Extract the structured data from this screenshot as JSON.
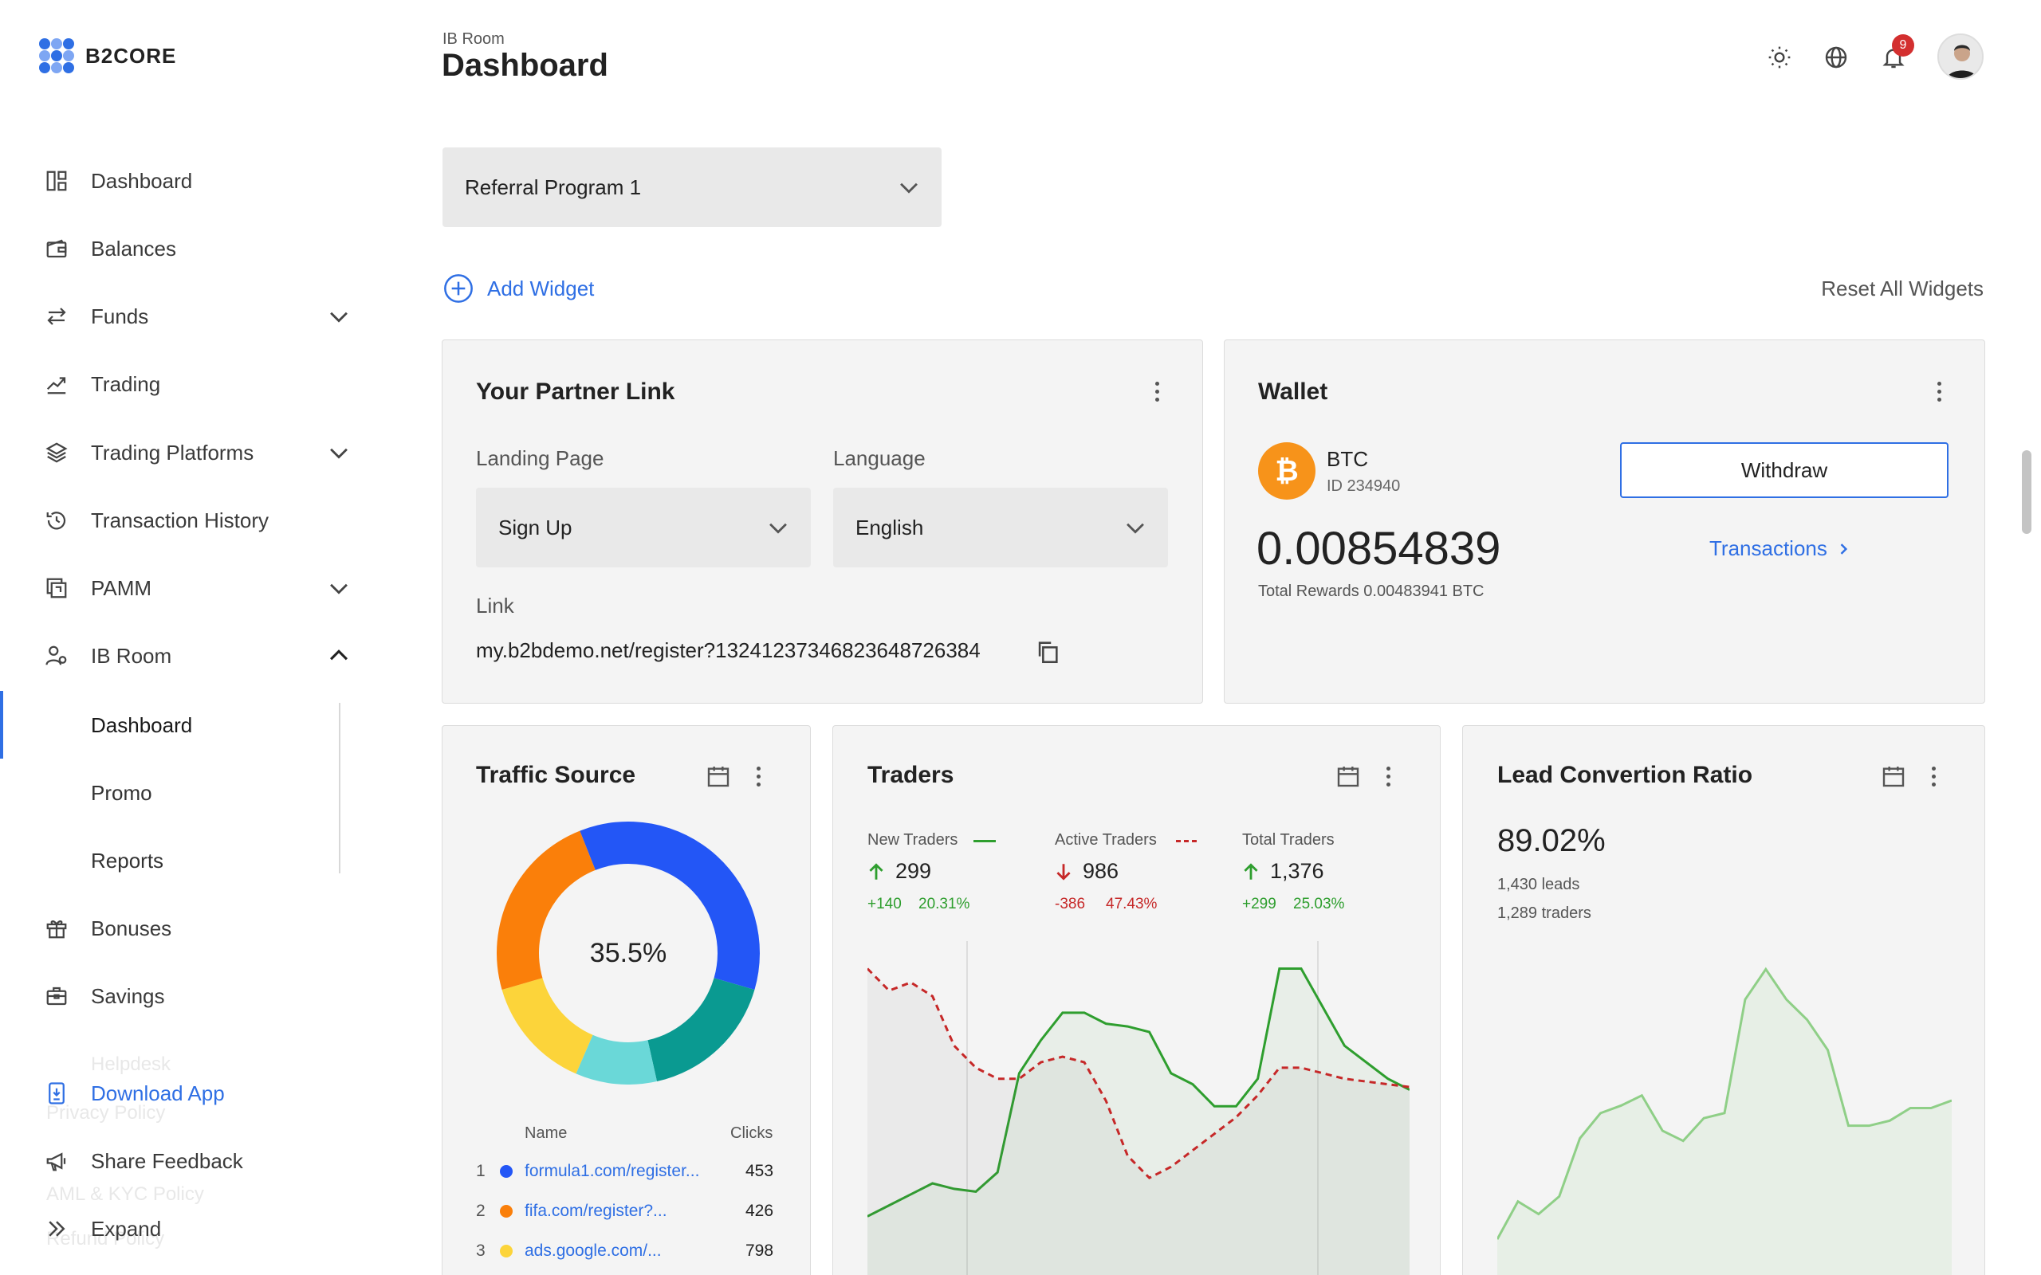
{
  "app": {
    "brand": "B2CORE"
  },
  "colors": {
    "accent": "#2f6fe4",
    "positive": "#2e9e2e",
    "negative": "#c62828",
    "btc": "#f7931a"
  },
  "sidebar": {
    "items": [
      {
        "label": "Dashboard",
        "icon": "dashboard-icon"
      },
      {
        "label": "Balances",
        "icon": "wallet-icon"
      },
      {
        "label": "Funds",
        "icon": "transfer-icon",
        "expandable": true
      },
      {
        "label": "Trading",
        "icon": "trending-icon"
      },
      {
        "label": "Trading Platforms",
        "icon": "layers-icon",
        "expandable": true
      },
      {
        "label": "Transaction History",
        "icon": "history-icon"
      },
      {
        "label": "PAMM",
        "icon": "pamm-icon",
        "expandable": true
      },
      {
        "label": "IB Room",
        "icon": "ib-room-icon",
        "expanded": true
      },
      {
        "label": "Bonuses",
        "icon": "gift-icon"
      },
      {
        "label": "Savings",
        "icon": "savings-icon"
      }
    ],
    "sub_items": [
      {
        "label": "Dashboard",
        "active": true
      },
      {
        "label": "Promo"
      },
      {
        "label": "Reports"
      }
    ],
    "ghost_items": [
      "Helpdesk",
      "Privacy Policy",
      "AML & KYC Policy",
      "Refund Policy"
    ],
    "bottom": {
      "download": "Download App",
      "feedback": "Share Feedback",
      "expand": "Expand"
    }
  },
  "header": {
    "breadcrumb": "IB Room",
    "title": "Dashboard",
    "notification_count": "9"
  },
  "program_select": {
    "value": "Referral Program 1"
  },
  "actions": {
    "add_widget": "Add Widget",
    "reset_widgets": "Reset All Widgets"
  },
  "partner_link": {
    "title": "Your Partner Link",
    "landing_label": "Landing Page",
    "landing_value": "Sign Up",
    "language_label": "Language",
    "language_value": "English",
    "link_label": "Link",
    "link_value": "my.b2bdemo.net/register?132412373468236487263​84"
  },
  "wallet": {
    "title": "Wallet",
    "currency": "BTC",
    "id": "ID 234940",
    "balance": "0.00854839",
    "rewards": "Total Rewards 0.00483941 BTC",
    "withdraw": "Withdraw",
    "transactions": "Transactions"
  },
  "traffic": {
    "title": "Traffic Source",
    "center": "35.5%",
    "col_name": "Name",
    "col_clicks": "Clicks",
    "rows": [
      {
        "num": "1",
        "name": "formula1.com/register...",
        "clicks": "453",
        "color": "#2356f6"
      },
      {
        "num": "2",
        "name": "fifa.com/register?...",
        "clicks": "426",
        "color": "#fa7f0a"
      },
      {
        "num": "3",
        "name": "ads.google.com/...",
        "clicks": "798",
        "color": "#fcd43a"
      }
    ]
  },
  "traders": {
    "title": "Traders",
    "new": {
      "label": "New Traders",
      "value": "299",
      "delta": "+140",
      "pct": "20.31%"
    },
    "active": {
      "label": "Active Traders",
      "value": "986",
      "delta": "-386",
      "pct": "47.43%"
    },
    "total": {
      "label": "Total Traders",
      "value": "1,376",
      "delta": "+299",
      "pct": "25.03%"
    }
  },
  "lead": {
    "title": "Lead Convertion Ratio",
    "ratio": "89.02%",
    "leads": "1,430 leads",
    "traders": "1,289 traders"
  },
  "chart_data": [
    {
      "type": "pie",
      "title": "Traffic Source",
      "center_label": "35.5%",
      "slices": [
        {
          "color": "#2356f6",
          "value": 35.5
        },
        {
          "color": "#0a9a91",
          "value": 17.0
        },
        {
          "color": "#6ad8d8",
          "value": 10.0
        },
        {
          "color": "#fcd43a",
          "value": 14.0
        },
        {
          "color": "#fa7f0a",
          "value": 23.5
        }
      ]
    },
    {
      "type": "line",
      "title": "Traders",
      "series": [
        {
          "name": "New Traders",
          "color": "#2e9e2e",
          "style": "solid",
          "values": [
            10,
            14,
            18,
            22,
            20,
            19,
            26,
            62,
            74,
            84,
            84,
            80,
            79,
            77,
            62,
            58,
            50,
            50,
            60,
            100,
            100,
            86,
            72,
            66,
            60,
            56
          ]
        },
        {
          "name": "Active Traders",
          "color": "#c62828",
          "style": "dashed",
          "values": [
            100,
            92,
            95,
            90,
            72,
            64,
            60,
            60,
            66,
            68,
            66,
            52,
            32,
            24,
            28,
            34,
            40,
            46,
            54,
            64,
            64,
            62,
            60,
            59,
            58,
            57
          ]
        }
      ]
    },
    {
      "type": "area",
      "title": "Lead Convertion Ratio",
      "series": [
        {
          "name": "Lead Convertion Ratio",
          "color": "#8fcf87",
          "values": [
            5,
            20,
            15,
            22,
            45,
            55,
            58,
            62,
            48,
            44,
            53,
            55,
            100,
            112,
            100,
            92,
            80,
            50,
            50,
            52,
            57,
            57,
            60
          ]
        }
      ]
    }
  ]
}
